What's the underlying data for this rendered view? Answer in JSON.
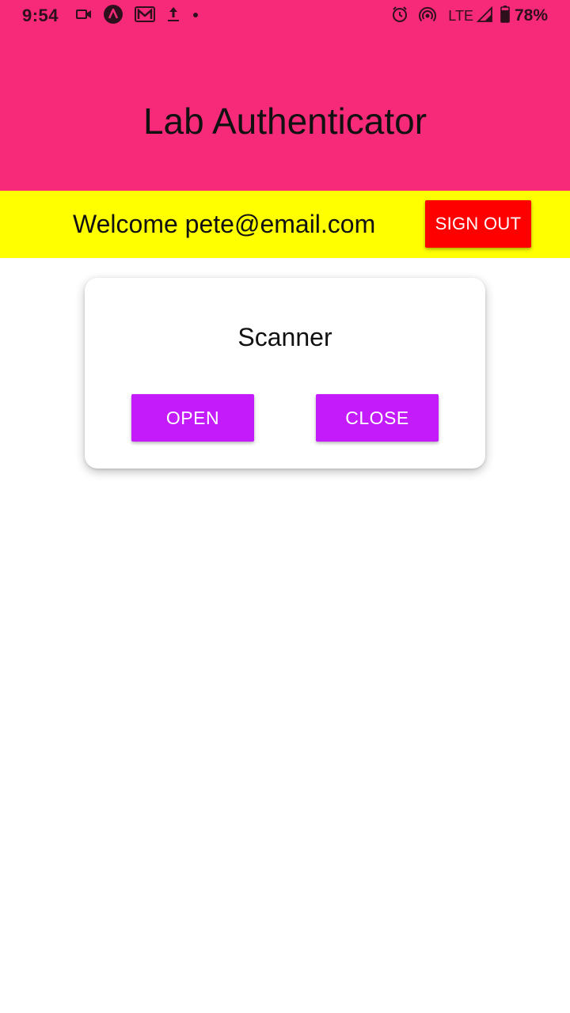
{
  "status_bar": {
    "time": "9:54",
    "left_icons": [
      "video-camera-icon",
      "app-circle-icon",
      "gmail-icon",
      "upload-icon",
      "dot-icon"
    ],
    "right_icons": [
      "alarm-icon",
      "hotspot-icon",
      "signal-icon",
      "battery-icon"
    ],
    "network": "LTE",
    "battery": "78%"
  },
  "header": {
    "title": "Lab Authenticator"
  },
  "welcome": {
    "text": "Welcome pete@email.com",
    "signout_label": "SIGN OUT"
  },
  "scanner": {
    "title": "Scanner",
    "open_label": "OPEN",
    "close_label": "CLOSE"
  },
  "colors": {
    "header_bg": "#f72a7a",
    "welcome_bg": "#ffff00",
    "signout_bg": "#ff0000",
    "action_bg": "#c41bfa"
  }
}
